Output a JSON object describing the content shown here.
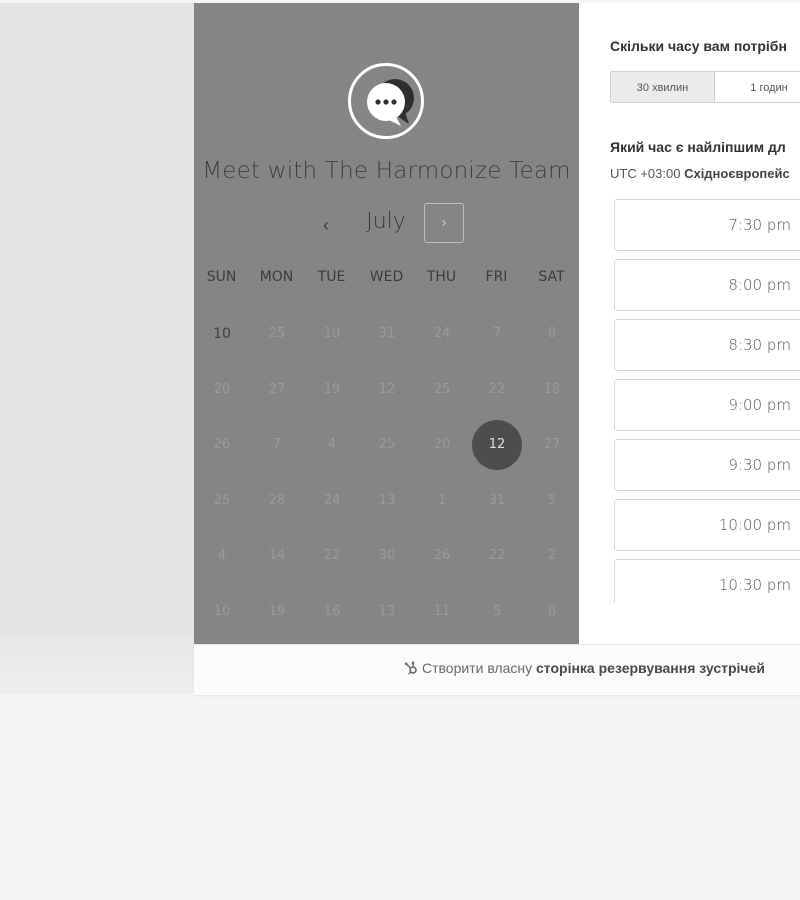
{
  "calendar": {
    "title": "Meet with The Harmonize Team",
    "month": "July",
    "prev_label": "‹",
    "next_label": "›",
    "weekdays": [
      "SUN",
      "MON",
      "TUE",
      "WED",
      "THU",
      "FRI",
      "SAT"
    ],
    "rows": [
      [
        "10",
        "25",
        "10",
        "31",
        "24",
        "7",
        "8"
      ],
      [
        "20",
        "27",
        "19",
        "12",
        "25",
        "22",
        "18"
      ],
      [
        "26",
        "7",
        "4",
        "25",
        "20",
        "12",
        "27"
      ],
      [
        "25",
        "28",
        "24",
        "13",
        "1",
        "31",
        "5"
      ],
      [
        "4",
        "14",
        "22",
        "30",
        "26",
        "22",
        "2"
      ],
      [
        "10",
        "19",
        "16",
        "13",
        "11",
        "5",
        "8"
      ]
    ],
    "active_day": {
      "row": 0,
      "col": 0
    },
    "selected_day": {
      "row": 2,
      "col": 5
    }
  },
  "booking": {
    "duration_question": "Скільки часу вам потрібн",
    "durations": [
      "30 хвилин",
      "1 годин"
    ],
    "selected_duration": "30 хвилин",
    "time_question": "Який час є найліпшим дл",
    "timezone_offset": "UTC +03:00",
    "timezone_name": "Східноєвропейс",
    "slots": [
      "7:30 pm",
      "8:00 pm",
      "8:30 pm",
      "9:00 pm",
      "9:30 pm",
      "10:00 pm",
      "10:30 pm"
    ]
  },
  "footer": {
    "prefix": "Створити власну",
    "link": "сторінка резервування зустрічей"
  },
  "colors": {
    "calendar_panel": "#858585",
    "selected_day": "#4d4d4d",
    "page_bg": "#f5f5f5"
  }
}
